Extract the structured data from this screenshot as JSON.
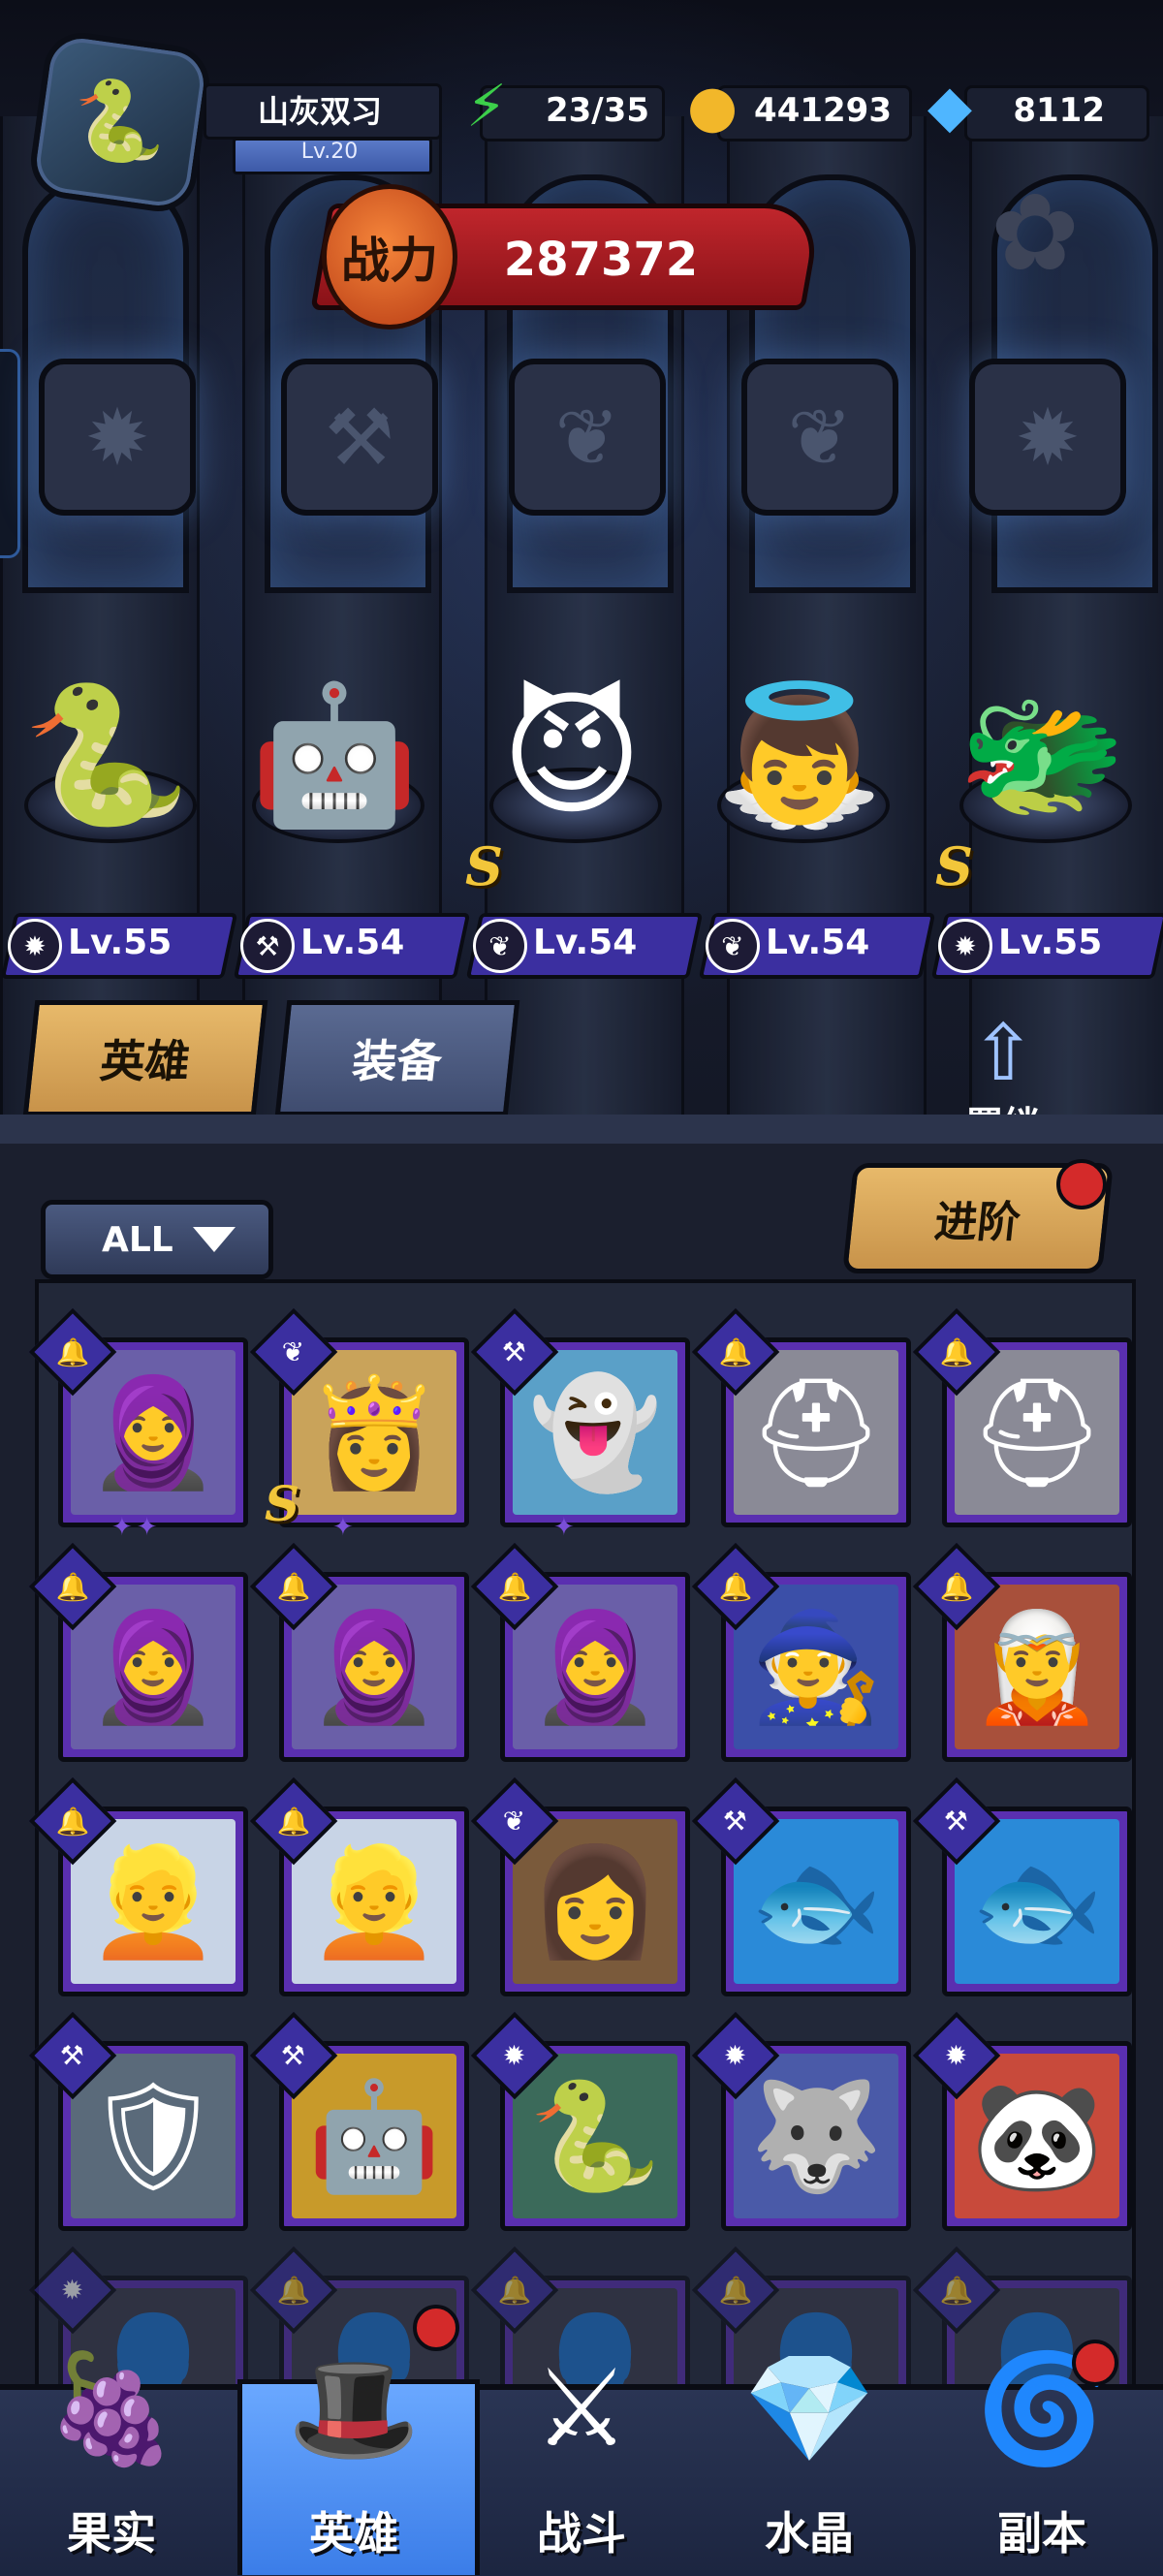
{
  "player": {
    "name": "山灰双习",
    "level": "Lv.20",
    "avatar_icon": "medusa-portrait"
  },
  "resources": [
    {
      "name": "energy",
      "icon": "lightning-icon",
      "value": "23/35",
      "color": "#3ccf4a"
    },
    {
      "name": "gold",
      "icon": "gold-coin-icon",
      "value": "441293",
      "color": "#f2b72a"
    },
    {
      "name": "diamond",
      "icon": "diamond-icon",
      "value": "8112",
      "color": "#4fb6ff"
    }
  ],
  "power": {
    "label": "战力",
    "value": "287372"
  },
  "lineup": [
    {
      "level": "Lv.55",
      "class_icon": "beast-class-icon",
      "s_rank": false
    },
    {
      "level": "Lv.54",
      "class_icon": "wrench-class-icon",
      "s_rank": false
    },
    {
      "level": "Lv.54",
      "class_icon": "wing-class-icon",
      "s_rank": true
    },
    {
      "level": "Lv.54",
      "class_icon": "wing-class-icon",
      "s_rank": false
    },
    {
      "level": "Lv.55",
      "class_icon": "beast-class-icon",
      "s_rank": true
    }
  ],
  "s_mark": "S",
  "tabs": {
    "heroes": "英雄",
    "equipment": "装备"
  },
  "bond": {
    "label": "羁绊"
  },
  "filter": {
    "label": "ALL"
  },
  "advance": {
    "label": "进阶"
  },
  "nav": [
    {
      "label": "果实",
      "icon": "fruit-icon",
      "badge": false
    },
    {
      "label": "英雄",
      "icon": "hero-hat-icon",
      "badge": true,
      "active": true
    },
    {
      "label": "战斗",
      "icon": "battle-sword-icon",
      "badge": false
    },
    {
      "label": "水晶",
      "icon": "crystal-icon",
      "badge": false
    },
    {
      "label": "副本",
      "icon": "dungeon-portal-icon",
      "badge": true
    }
  ],
  "colors": {
    "accent_gold": "#e7b96a",
    "card_purple": "#5a2fb0",
    "badge_red": "#d42a2a",
    "level_purple": "#3b2fa0"
  }
}
